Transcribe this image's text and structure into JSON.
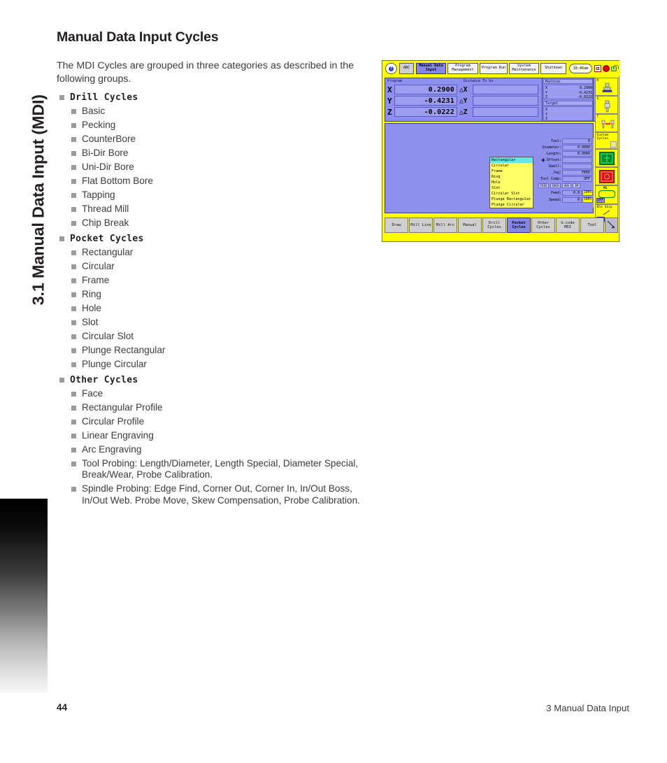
{
  "sidebar": {
    "chapter_title": "3.1 Manual Data Input (MDI)"
  },
  "page": {
    "heading": "Manual Data Input Cycles",
    "intro": "The MDI Cycles are grouped in three categories as described in the following groups."
  },
  "groups": [
    {
      "label": "Drill Cycles",
      "items": [
        "Basic",
        "Pecking",
        "CounterBore",
        "Bi-Dir Bore",
        "Uni-Dir Bore",
        "Flat Bottom Bore",
        "Tapping",
        "Thread Mill",
        "Chip Break"
      ]
    },
    {
      "label": "Pocket Cycles",
      "items": [
        "Rectangular",
        "Circular",
        "Frame",
        "Ring",
        "Hole",
        "Slot",
        "Circular Slot",
        "Plunge Rectangular",
        "Plunge Circular"
      ]
    },
    {
      "label": "Other Cycles",
      "items": [
        "Face",
        "Rectangular Profile",
        "Circular Profile",
        "Linear Engraving",
        "Arc Engraving",
        "Tool Probing: Length/Diameter, Length Special, Diameter Special, Break/Wear, Probe Calibration.",
        "Spindle Probing: Edge Find, Corner Out, Corner In, In/Out Boss, In/Out Web. Probe Move, Skew Compensation, Probe Calibration."
      ]
    }
  ],
  "footer": {
    "page_number": "44",
    "section": "3 Manual Data Input"
  },
  "cnc": {
    "toolbar": {
      "help_glyph": "?",
      "abc_label": "ABC",
      "buttons": [
        {
          "label": "Manual Data Input",
          "selected": true
        },
        {
          "label": "Program Management",
          "selected": false
        },
        {
          "label": "Program Run",
          "selected": false
        },
        {
          "label": "System Maintenance",
          "selected": false
        },
        {
          "label": "Shutdown",
          "selected": false
        }
      ],
      "clock": "10:46am",
      "icons": [
        "record-icon",
        "estop-icon",
        "unlock-icon"
      ]
    },
    "dro": {
      "header_program": "Program",
      "header_dtg": "Distance To Go",
      "axes": [
        {
          "letter": "X",
          "value": "0.2900",
          "delta_letter": "X",
          "dtg": ""
        },
        {
          "letter": "Y",
          "value": "-0.4231",
          "delta_letter": "Y",
          "dtg": ""
        },
        {
          "letter": "Z",
          "value": "-0.0222",
          "delta_letter": "Z",
          "dtg": ""
        }
      ]
    },
    "machine": {
      "machine_label": "Machine",
      "machine_rows": [
        {
          "axis": "X",
          "value": "0.2900"
        },
        {
          "axis": "Y",
          "value": "-0.4231"
        },
        {
          "axis": "Z",
          "value": "-0.0222"
        }
      ],
      "target_label": "Target",
      "target_rows": [
        {
          "axis": "X",
          "value": ""
        },
        {
          "axis": "Y",
          "value": ""
        },
        {
          "axis": "Z",
          "value": ""
        }
      ]
    },
    "rail": [
      {
        "label": "M",
        "icon": "spindle-m-icon"
      },
      {
        "label": "S",
        "icon": "spindle-s-icon"
      },
      {
        "label": "T",
        "icon": "tool-changer-icon"
      },
      {
        "label": "Custom Cycles",
        "icon": "custom-cycles-icon"
      },
      {
        "label": "",
        "icon": "green-part-icon"
      },
      {
        "label": "",
        "icon": "red-part-icon"
      },
      {
        "label": "M1",
        "icon": "optional-stop-icon",
        "state": "OFF"
      },
      {
        "label": "Blk Skip",
        "icon": "block-skip-icon",
        "state": "OFF"
      }
    ],
    "cycle_list": {
      "selected": "Rectangular",
      "options": [
        "Rectangular",
        "Circular",
        "Frame",
        "Ring",
        "Hole",
        "Slot",
        "Circular Slot",
        "Plunge Rectangular",
        "Plunge Circular"
      ]
    },
    "tool_info": {
      "rows": [
        {
          "label": "Tool:",
          "value": "0"
        },
        {
          "label": "Diameter:",
          "value": "0.0000"
        },
        {
          "label": "Length:",
          "value": "0.0000"
        },
        {
          "label": "Offset:",
          "value": ""
        },
        {
          "label": "Dwell:",
          "value": ""
        },
        {
          "label": "Jog:",
          "value": "FEED"
        },
        {
          "label": "Tool Comp:",
          "value": "OFF"
        }
      ],
      "unit_buttons": [
        "FEED",
        "INCH",
        "ABS",
        "IM"
      ],
      "feed": {
        "label": "Feed:",
        "value": "0.0",
        "percent": "100%"
      },
      "speed": {
        "label": "Speed:",
        "value": "0",
        "percent": "100%"
      }
    },
    "softkeys": [
      {
        "label": "Draw",
        "selected": false
      },
      {
        "label": "Mill Line",
        "selected": false
      },
      {
        "label": "Mill Arc",
        "selected": false
      },
      {
        "label": "Manual",
        "selected": false
      },
      {
        "label": "Drill Cycles",
        "selected": false
      },
      {
        "label": "Pocket Cycles",
        "selected": true
      },
      {
        "label": "Other Cycles",
        "selected": false
      },
      {
        "label": "G-code MDI",
        "selected": false
      },
      {
        "label": "Tool",
        "selected": false
      }
    ]
  },
  "colors": {
    "panel_blue": "#8f8fee",
    "toolbar_yellow": "#ffff00",
    "selected_blue": "#8686e8",
    "list_yellow": "#ffff66",
    "highlight_cyan": "#66e6e6",
    "softkey_grey": "#cfcfcf"
  }
}
